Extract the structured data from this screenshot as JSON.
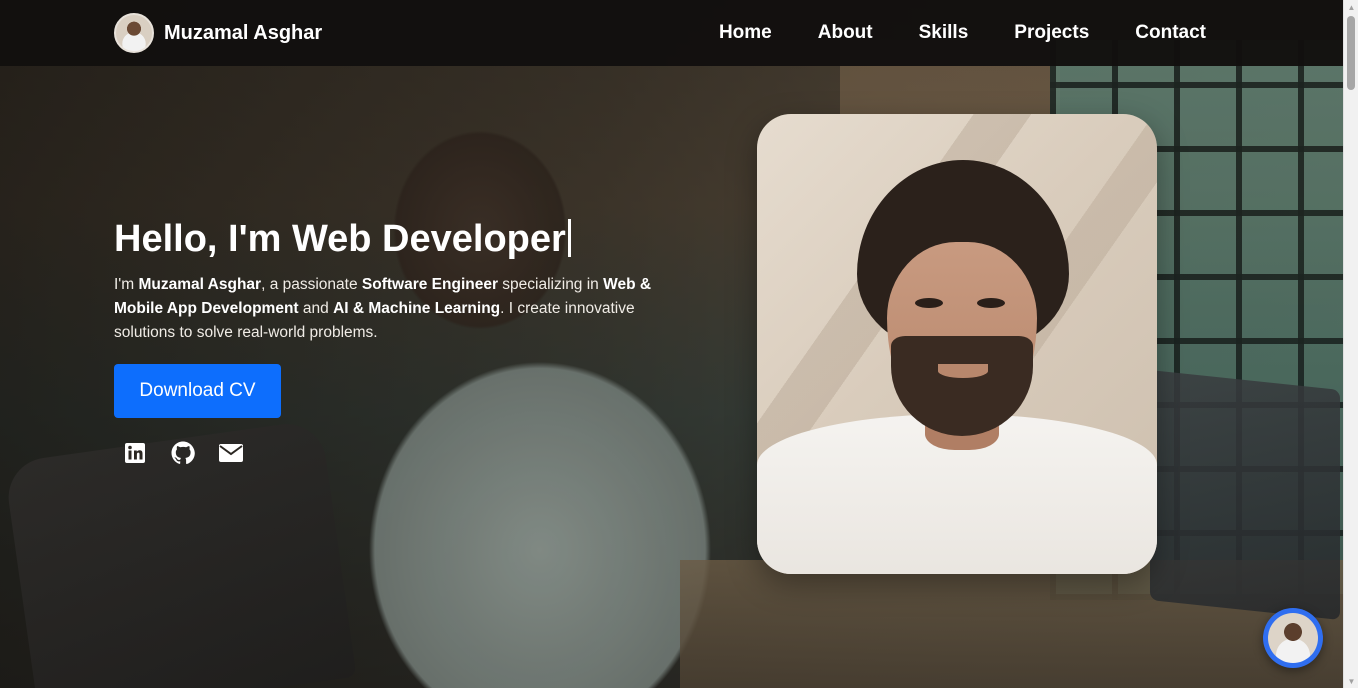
{
  "navbar": {
    "brand_name": "Muzamal Asghar",
    "links": [
      "Home",
      "About",
      "Skills",
      "Projects",
      "Contact"
    ]
  },
  "hero": {
    "title": "Hello, I'm Web Developer",
    "desc": {
      "p1": "I'm ",
      "name": "Muzamal Asghar",
      "p2": ", a passionate ",
      "role": "Software Engineer",
      "p3": " specializing in ",
      "area1": "Web & Mobile App Development",
      "p4": " and ",
      "area2": "AI & Machine Learning",
      "p5": ". I create innovative solutions to solve real-world problems."
    },
    "cv_button": "Download CV",
    "socials": [
      "linkedin-icon",
      "github-icon",
      "envelope-icon"
    ]
  },
  "colors": {
    "accent": "#0d6efd",
    "navbar_bg": "#121010",
    "chat_ring": "#2f6ef0"
  }
}
